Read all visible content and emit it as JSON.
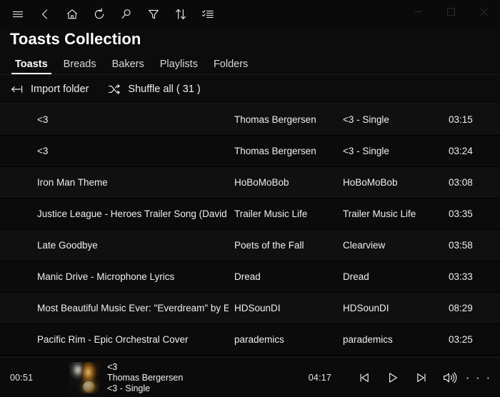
{
  "window": {
    "controls": [
      {
        "name": "minimize",
        "glyph": "minimize-icon"
      },
      {
        "name": "maximize",
        "glyph": "maximize-icon"
      },
      {
        "name": "close",
        "glyph": "close-icon"
      }
    ]
  },
  "toolbar": {
    "items": [
      {
        "icon": "hamburger-menu-icon",
        "label": "Menu"
      },
      {
        "icon": "back-arrow-icon",
        "label": "Back"
      },
      {
        "icon": "home-icon",
        "label": "Home"
      },
      {
        "icon": "refresh-icon",
        "label": "Refresh"
      },
      {
        "icon": "search-icon",
        "label": "Search"
      },
      {
        "icon": "filter-icon",
        "label": "Filter"
      },
      {
        "icon": "sort-icon",
        "label": "Sort"
      },
      {
        "icon": "select-list-icon",
        "label": "Select"
      }
    ]
  },
  "header": {
    "title": "Toasts Collection"
  },
  "tabs": {
    "active_index": 0,
    "items": [
      {
        "label": "Toasts"
      },
      {
        "label": "Breads"
      },
      {
        "label": "Bakers"
      },
      {
        "label": "Playlists"
      },
      {
        "label": "Folders"
      }
    ]
  },
  "commandbar": {
    "import": {
      "label": "Import folder",
      "icon": "import-arrow-icon"
    },
    "shuffle": {
      "label": "Shuffle all ( 31 )",
      "icon": "shuffle-icon"
    }
  },
  "tracklist": {
    "rows": [
      {
        "title": "<3",
        "artist": "Thomas Bergersen",
        "album": "<3 - Single",
        "duration": "03:15"
      },
      {
        "title": "<3",
        "artist": "Thomas Bergersen",
        "album": "<3 - Single",
        "duration": "03:24"
      },
      {
        "title": "Iron Man Theme",
        "artist": "HoBoMoBob",
        "album": "HoBoMoBob",
        "duration": "03:08"
      },
      {
        "title": "Justice League - Heroes Trailer Song (David Bc",
        "artist": "Trailer Music Life",
        "album": "Trailer Music Life",
        "duration": "03:35"
      },
      {
        "title": "Late Goodbye",
        "artist": "Poets of the Fall",
        "album": "Clearview",
        "duration": "03:58"
      },
      {
        "title": "Manic Drive - Microphone Lyrics",
        "artist": "Dread",
        "album": "Dread",
        "duration": "03:33"
      },
      {
        "title": "Most Beautiful Music Ever: \"Everdream\" by Epi",
        "artist": "HDSounDI",
        "album": "HDSounDI",
        "duration": "08:29"
      },
      {
        "title": "Pacific Rim - Epic Orchestral Cover",
        "artist": "parademics",
        "album": "parademics",
        "duration": "03:25"
      }
    ]
  },
  "player": {
    "elapsed": "00:51",
    "total": "04:17",
    "now_playing": {
      "title": "<3",
      "artist": "Thomas Bergersen",
      "album": "<3 - Single"
    },
    "controls": [
      {
        "name": "previous",
        "icon": "previous-track-icon"
      },
      {
        "name": "play",
        "icon": "play-icon"
      },
      {
        "name": "next",
        "icon": "next-track-icon"
      },
      {
        "name": "volume",
        "icon": "volume-icon"
      },
      {
        "name": "more",
        "icon": "more-options-icon",
        "glyph": "· · ·"
      }
    ]
  },
  "colors": {
    "background": "#0c0c0c",
    "row": "#101010",
    "row_alt": "#0b0b0b",
    "text": "#efefef",
    "accent": "#ffffff"
  }
}
